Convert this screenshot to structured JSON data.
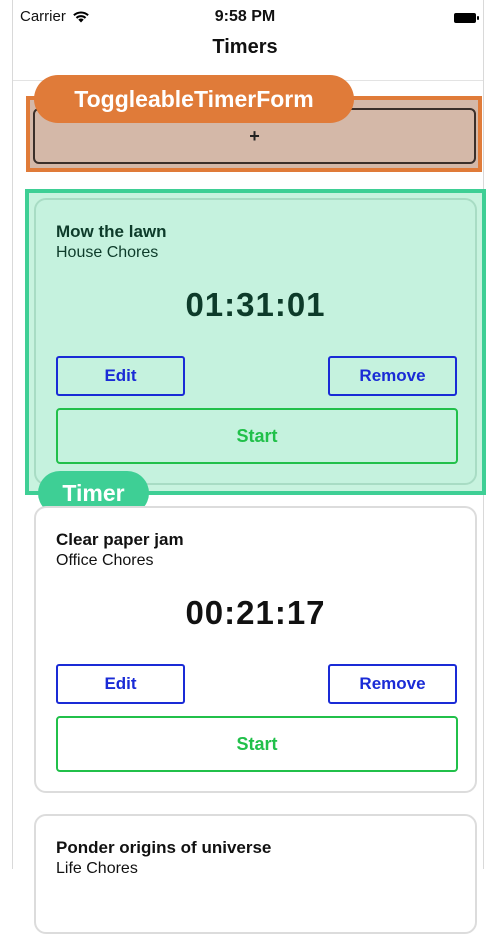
{
  "status_bar": {
    "carrier": "Carrier",
    "time": "9:58 PM"
  },
  "nav": {
    "title": "Timers"
  },
  "annotations": {
    "form_label": "ToggleableTimerForm",
    "timer_label": "Timer"
  },
  "form": {
    "add_label": "+"
  },
  "timers": [
    {
      "title": "Mow the lawn",
      "project": "House Chores",
      "elapsed": "01:31:01",
      "edit": "Edit",
      "remove": "Remove",
      "start": "Start"
    },
    {
      "title": "Clear paper jam",
      "project": "Office Chores",
      "elapsed": "00:21:17",
      "edit": "Edit",
      "remove": "Remove",
      "start": "Start"
    },
    {
      "title": "Ponder origins of universe",
      "project": "Life Chores"
    }
  ],
  "colors": {
    "form_annotation": "#e07b39",
    "timer_annotation": "#3ecf95",
    "action_blue": "#1a2bd6",
    "start_green": "#21c04a"
  }
}
